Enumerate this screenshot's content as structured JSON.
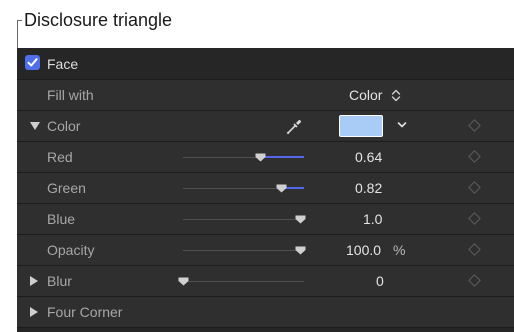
{
  "callout": {
    "label": "Disclosure triangle"
  },
  "inspector": {
    "face": {
      "label": "Face",
      "checked": true
    },
    "fill_with": {
      "label": "Fill with",
      "value": "Color",
      "icon": "up-down-arrows-icon"
    },
    "color": {
      "label": "Color",
      "expanded": true,
      "swatch_color": "#a8ccf5",
      "icons": [
        "eyedropper-icon",
        "chevron-down-icon"
      ]
    },
    "red": {
      "label": "Red",
      "value": "0.64",
      "slider_fraction": 0.64
    },
    "green": {
      "label": "Green",
      "value": "0.82",
      "slider_fraction": 0.82
    },
    "blue": {
      "label": "Blue",
      "value": "1.0",
      "slider_fraction": 1.0
    },
    "opacity": {
      "label": "Opacity",
      "value": "100.0",
      "unit": "%",
      "slider_fraction": 1.0
    },
    "blur": {
      "label": "Blur",
      "value": "0",
      "slider_fraction": 0.0,
      "expanded": false
    },
    "four_corner": {
      "label": "Four Corner",
      "expanded": false
    }
  },
  "colors": {
    "accent": "#5566ee",
    "checkbox": "#4f6fe8",
    "panel_bg": "#262626",
    "row_bg": "#2f2f2f"
  }
}
